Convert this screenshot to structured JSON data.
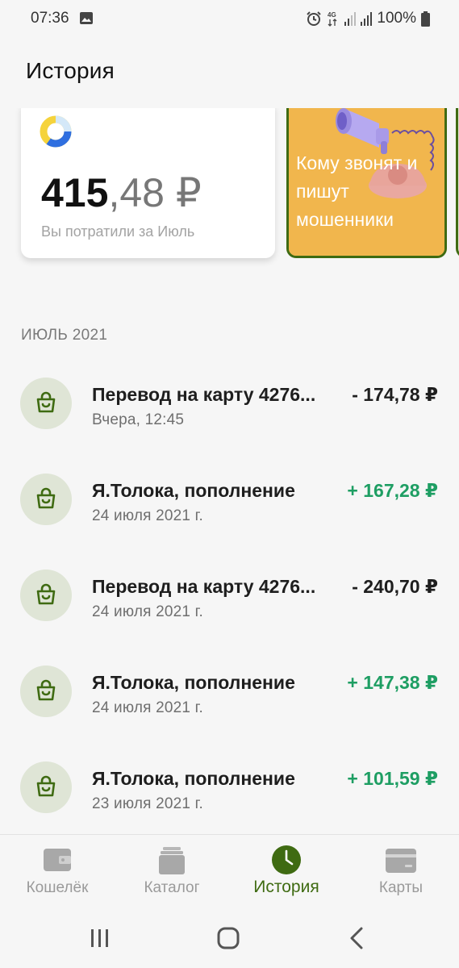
{
  "status_bar": {
    "time": "07:36",
    "network": "4G",
    "battery": "100%"
  },
  "header": {
    "title": "История"
  },
  "spend_card": {
    "amount_whole": "415",
    "amount_fraction": ",48 ₽",
    "caption": "Вы потратили за Июль"
  },
  "promo_card": {
    "text": "Кому звонят и пишут мошенники"
  },
  "section": {
    "title": "ИЮЛЬ 2021"
  },
  "transactions": [
    {
      "title": "Перевод на карту 4276...",
      "date": "Вчера, 12:45",
      "amount": "- 174,78 ₽",
      "positive": false
    },
    {
      "title": "Я.Толока, пополнение",
      "date": "24 июля 2021 г.",
      "amount": "+ 167,28 ₽",
      "positive": true
    },
    {
      "title": "Перевод на карту 4276...",
      "date": "24 июля 2021 г.",
      "amount": "- 240,70 ₽",
      "positive": false
    },
    {
      "title": "Я.Толока, пополнение",
      "date": "24 июля 2021 г.",
      "amount": "+ 147,38 ₽",
      "positive": true
    },
    {
      "title": "Я.Толока, пополнение",
      "date": "23 июля 2021 г.",
      "amount": "+ 101,59 ₽",
      "positive": true
    }
  ],
  "bottom_nav": {
    "items": [
      {
        "label": "Кошелёк",
        "icon": "wallet-icon",
        "active": false
      },
      {
        "label": "Каталог",
        "icon": "catalog-icon",
        "active": false
      },
      {
        "label": "История",
        "icon": "clock-icon",
        "active": true
      },
      {
        "label": "Карты",
        "icon": "card-icon",
        "active": false
      }
    ]
  },
  "colors": {
    "accent": "#3f6b12",
    "positive": "#1e9e63",
    "icon_bg": "#dfe5d6",
    "promo_bg": "#f1b64d"
  }
}
